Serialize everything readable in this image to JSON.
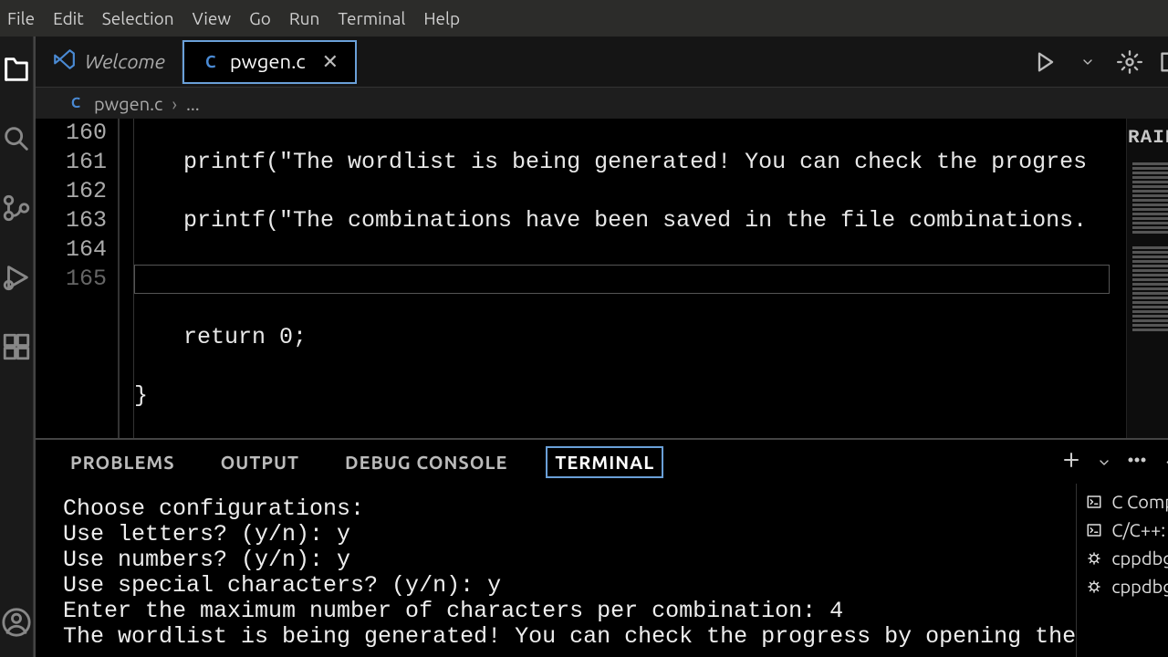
{
  "menu": {
    "file": "File",
    "edit": "Edit",
    "selection": "Selection",
    "view": "View",
    "go": "Go",
    "run": "Run",
    "terminal": "Terminal",
    "help": "Help"
  },
  "tabs": {
    "welcome": "Welcome",
    "file": "pwgen.c"
  },
  "breadcrumb": {
    "file": "pwgen.c",
    "more": "..."
  },
  "editor": {
    "lines": {
      "l160": "160",
      "l161": "161",
      "l162": "162",
      "l163": "163",
      "l164": "164",
      "l165": "165"
    },
    "code": {
      "l160": "printf(\"The wordlist is being generated! You can check the progres",
      "l161": "printf(\"The combinations have been saved in the file combinations.",
      "l162": "",
      "l163": "return 0;",
      "l164": "}",
      "l165": ""
    }
  },
  "minimap": {
    "title": "RAIDER"
  },
  "panel": {
    "tabs": {
      "problems": "PROBLEMS",
      "output": "OUTPUT",
      "debug": "DEBUG CONSOLE",
      "terminal": "TERMINAL"
    },
    "terminal_output": "Choose configurations:\nUse letters? (y/n): y\nUse numbers? (y/n): y\nUse special characters? (y/n): y\nEnter the maximum number of characters per combination: 4\nThe wordlist is being generated! You can check the progress by opening the",
    "terminals": {
      "t1": "C Compiler...",
      "t2": "C/C++: ...",
      "t3": "cppdbg: p...",
      "t4": "cppdbg: p..."
    }
  }
}
